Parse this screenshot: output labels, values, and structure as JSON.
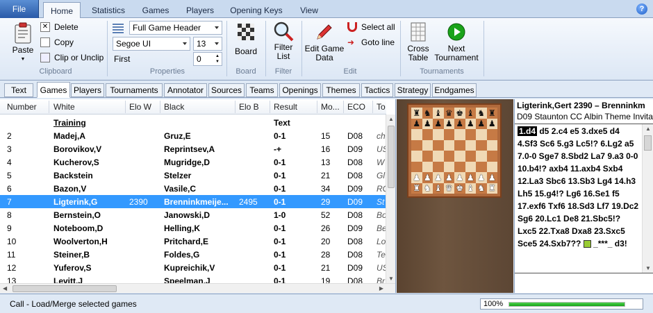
{
  "ribbon": {
    "file": "File",
    "tabs": [
      "Home",
      "Statistics",
      "Games",
      "Players",
      "Opening Keys",
      "View"
    ],
    "clipboard": {
      "paste": "Paste",
      "delete": "Delete",
      "copy": "Copy",
      "clip": "Clip or Unclip",
      "label": "Clipboard"
    },
    "properties": {
      "header": "Full Game Header",
      "font": "Segoe UI",
      "size": "13",
      "first_label": "First",
      "first_value": "0",
      "label": "Properties"
    },
    "board": {
      "button": "Board",
      "label": "Board"
    },
    "filter": {
      "button_line1": "Filter",
      "button_line2": "List",
      "label": "Filter"
    },
    "edit": {
      "edit_line1": "Edit Game",
      "edit_line2": "Data",
      "select_all": "Select all",
      "goto_line": "Goto line",
      "label": "Edit"
    },
    "tournaments": {
      "cross_line1": "Cross",
      "cross_line2": "Table",
      "next_line1": "Next",
      "next_line2": "Tournament",
      "label": "Tournaments"
    }
  },
  "subtabs": [
    "Text",
    "Games",
    "Players",
    "Tournaments",
    "Annotator",
    "Sources",
    "Teams",
    "Openings",
    "Themes",
    "Tactics",
    "Strategy",
    "Endgames"
  ],
  "columns": [
    "Number",
    "White",
    "Elo W",
    "Black",
    "Elo B",
    "Result",
    "Mo...",
    "ECO",
    "To"
  ],
  "rows": [
    {
      "n": "",
      "w": "Training",
      "ew": "",
      "b": "",
      "eb": "",
      "r": "Text",
      "m": "",
      "eco": "",
      "t": ""
    },
    {
      "n": "2",
      "w": "Madej,A",
      "ew": "",
      "b": "Gruz,E",
      "eb": "",
      "r": "0-1",
      "m": "15",
      "eco": "D08",
      "t": "ch"
    },
    {
      "n": "3",
      "w": "Borovikov,V",
      "ew": "",
      "b": "Reprintsev,A",
      "eb": "",
      "r": "-+",
      "m": "16",
      "eco": "D09",
      "t": "US"
    },
    {
      "n": "4",
      "w": "Kucherov,S",
      "ew": "",
      "b": "Mugridge,D",
      "eb": "",
      "r": "0-1",
      "m": "13",
      "eco": "D08",
      "t": "W"
    },
    {
      "n": "5",
      "w": "Backstein",
      "ew": "",
      "b": "Stelzer",
      "eb": "",
      "r": "0-1",
      "m": "21",
      "eco": "D08",
      "t": "Gl"
    },
    {
      "n": "6",
      "w": "Bazon,V",
      "ew": "",
      "b": "Vasile,C",
      "eb": "",
      "r": "0-1",
      "m": "34",
      "eco": "D09",
      "t": "RC"
    },
    {
      "n": "7",
      "w": "Ligterink,G",
      "ew": "2390",
      "b": "Brenninkmeije...",
      "eb": "2495",
      "r": "0-1",
      "m": "29",
      "eco": "D09",
      "t": "St"
    },
    {
      "n": "8",
      "w": "Bernstein,O",
      "ew": "",
      "b": "Janowski,D",
      "eb": "",
      "r": "1-0",
      "m": "52",
      "eco": "D08",
      "t": "Bo"
    },
    {
      "n": "9",
      "w": "Noteboom,D",
      "ew": "",
      "b": "Helling,K",
      "eb": "",
      "r": "0-1",
      "m": "26",
      "eco": "D09",
      "t": "Be"
    },
    {
      "n": "10",
      "w": "Woolverton,H",
      "ew": "",
      "b": "Pritchard,E",
      "eb": "",
      "r": "0-1",
      "m": "20",
      "eco": "D08",
      "t": "Lo"
    },
    {
      "n": "11",
      "w": "Steiner,B",
      "ew": "",
      "b": "Foldes,G",
      "eb": "",
      "r": "0-1",
      "m": "28",
      "eco": "D08",
      "t": "Te"
    },
    {
      "n": "12",
      "w": "Yuferov,S",
      "ew": "",
      "b": "Kupreichik,V",
      "eb": "",
      "r": "0-1",
      "m": "21",
      "eco": "D09",
      "t": "US"
    },
    {
      "n": "13",
      "w": "Levitt,J",
      "ew": "",
      "b": "Speelman,J",
      "eb": "",
      "r": "0-1",
      "m": "19",
      "eco": "D08",
      "t": "Br"
    }
  ],
  "notation": {
    "players": "Ligterink,Gert 2390 – Brenninkm",
    "opening": "D09 Staunton CC Albin Theme Invita",
    "first_move": "1.d4",
    "moves": " d5 2.c4 e5 3.dxe5 d4 4.Sf3 Sc6 5.g3 Lc5!? 6.Lg2 a5 7.0-0 Sge7 8.Sbd2 La7 9.a3 0-0 10.b4!? axb4 11.axb4 Sxb4 12.La3 Sbc6 13.Sb3 Lg4 14.h3 Lh5 15.g4!? Lg6 16.Se1 f5 17.exf6 Txf6 18.Sd3 Lf7 19.Dc2 Sg6 20.Lc1 De8 21.Sbc5!? Lxc5 22.Txa8 Dxa8 23.Sxc5 Sce5 24.Sxb7?? ",
    "tail": " _***_ d3!"
  },
  "status": {
    "text": "Call - Load/Merge selected games",
    "zoom": "100%",
    "progress": 1.0
  }
}
